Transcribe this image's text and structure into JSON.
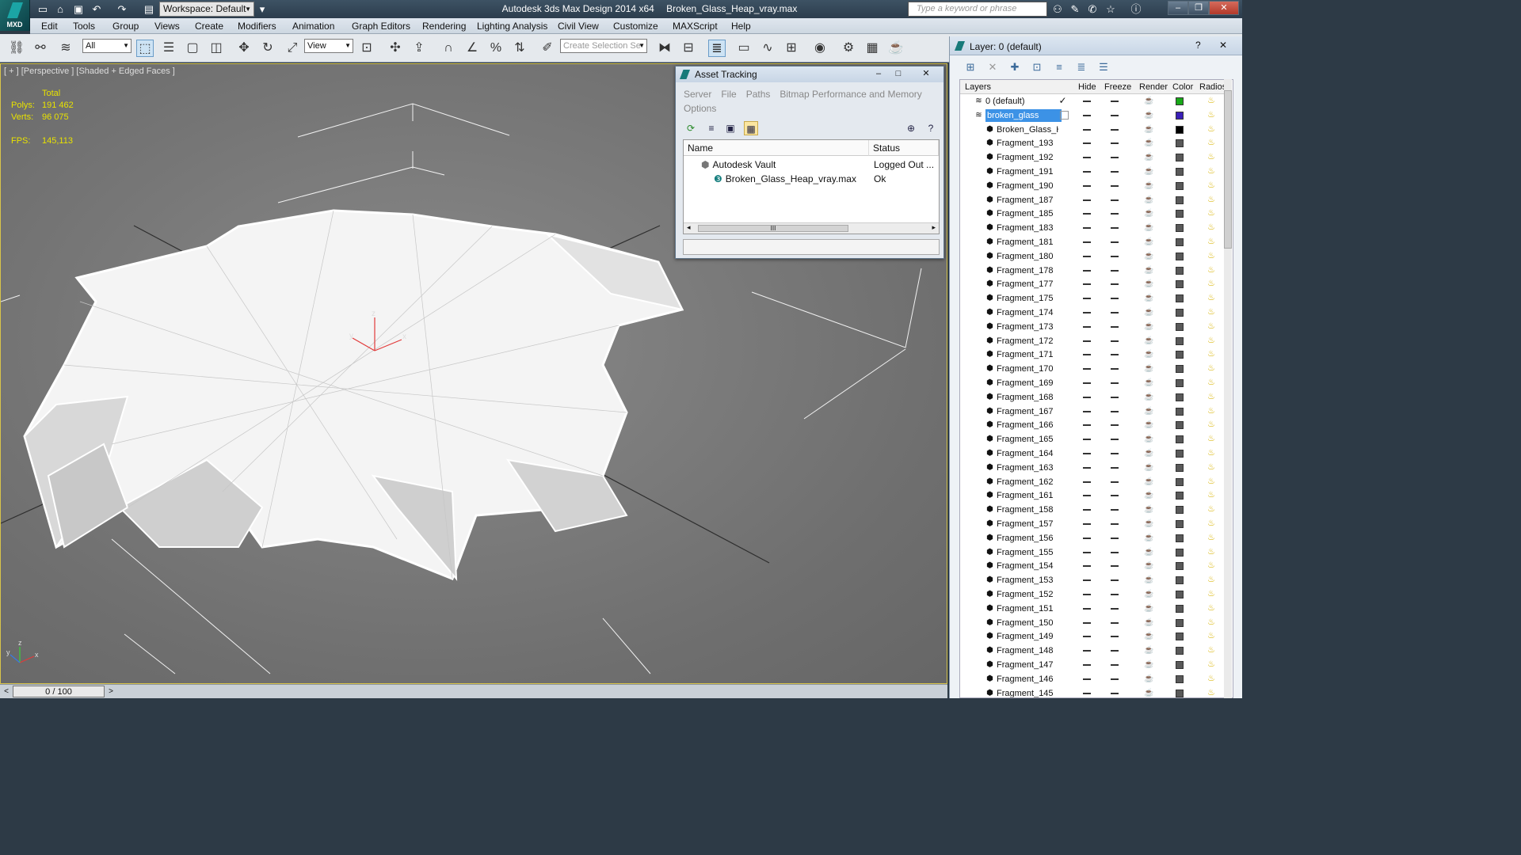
{
  "app": {
    "logo_text": "MXD",
    "title": "Autodesk 3ds Max Design 2014 x64",
    "file": "Broken_Glass_Heap_vray.max",
    "workspace": "Workspace: Default",
    "search_placeholder": "Type a keyword or phrase"
  },
  "menu": [
    "Edit",
    "Tools",
    "Group",
    "Views",
    "Create",
    "Modifiers",
    "Animation",
    "Graph Editors",
    "Rendering",
    "Lighting Analysis",
    "Civil View",
    "Customize",
    "MAXScript",
    "Help"
  ],
  "toolbar": {
    "filter_select": "All",
    "coord_select": "View",
    "selection_set_placeholder": "Create Selection Se"
  },
  "viewport": {
    "label": "[ + ] [Perspective ] [Shaded + Edged Faces ]",
    "stats_header": "Total",
    "polys_label": "Polys:",
    "polys_value": "191 462",
    "verts_label": "Verts:",
    "verts_value": "96 075",
    "fps_label": "FPS:",
    "fps_value": "145,113",
    "gizmo_x": "x",
    "gizmo_y": "y",
    "gizmo_z": "z"
  },
  "timeline": {
    "left": "<",
    "slider": "0 / 100",
    "right": ">"
  },
  "asset_tracking": {
    "title": "Asset Tracking",
    "menu": [
      "Server",
      "File",
      "Paths",
      "Bitmap Performance and Memory",
      "Options"
    ],
    "columns": [
      "Name",
      "Status"
    ],
    "rows": [
      {
        "name": "Autodesk Vault",
        "status": "Logged Out ..."
      },
      {
        "name": "Broken_Glass_Heap_vray.max",
        "status": "Ok"
      }
    ],
    "scroll_grip": "III"
  },
  "layer_panel": {
    "title": "Layer: 0 (default)",
    "help": "?",
    "close": "✕",
    "columns": [
      "Layers",
      "Hide",
      "Freeze",
      "Render",
      "Color",
      "Radios"
    ],
    "rows": [
      {
        "name": "0 (default)",
        "color": "#18a818",
        "kind": "layer",
        "check": true
      },
      {
        "name": "broken_glass",
        "color": "#3a1fb8",
        "kind": "layer",
        "selected": true
      },
      {
        "name": "Broken_Glass_He",
        "color": "#000000",
        "kind": "object"
      },
      {
        "name": "Fragment_193",
        "color": "#595959",
        "kind": "object"
      },
      {
        "name": "Fragment_192",
        "color": "#595959",
        "kind": "object"
      },
      {
        "name": "Fragment_191",
        "color": "#595959",
        "kind": "object"
      },
      {
        "name": "Fragment_190",
        "color": "#595959",
        "kind": "object"
      },
      {
        "name": "Fragment_187",
        "color": "#595959",
        "kind": "object"
      },
      {
        "name": "Fragment_185",
        "color": "#595959",
        "kind": "object"
      },
      {
        "name": "Fragment_183",
        "color": "#595959",
        "kind": "object"
      },
      {
        "name": "Fragment_181",
        "color": "#595959",
        "kind": "object"
      },
      {
        "name": "Fragment_180",
        "color": "#595959",
        "kind": "object"
      },
      {
        "name": "Fragment_178",
        "color": "#595959",
        "kind": "object"
      },
      {
        "name": "Fragment_177",
        "color": "#595959",
        "kind": "object"
      },
      {
        "name": "Fragment_175",
        "color": "#595959",
        "kind": "object"
      },
      {
        "name": "Fragment_174",
        "color": "#595959",
        "kind": "object"
      },
      {
        "name": "Fragment_173",
        "color": "#595959",
        "kind": "object"
      },
      {
        "name": "Fragment_172",
        "color": "#595959",
        "kind": "object"
      },
      {
        "name": "Fragment_171",
        "color": "#595959",
        "kind": "object"
      },
      {
        "name": "Fragment_170",
        "color": "#595959",
        "kind": "object"
      },
      {
        "name": "Fragment_169",
        "color": "#595959",
        "kind": "object"
      },
      {
        "name": "Fragment_168",
        "color": "#595959",
        "kind": "object"
      },
      {
        "name": "Fragment_167",
        "color": "#595959",
        "kind": "object"
      },
      {
        "name": "Fragment_166",
        "color": "#595959",
        "kind": "object"
      },
      {
        "name": "Fragment_165",
        "color": "#595959",
        "kind": "object"
      },
      {
        "name": "Fragment_164",
        "color": "#595959",
        "kind": "object"
      },
      {
        "name": "Fragment_163",
        "color": "#595959",
        "kind": "object"
      },
      {
        "name": "Fragment_162",
        "color": "#595959",
        "kind": "object"
      },
      {
        "name": "Fragment_161",
        "color": "#595959",
        "kind": "object"
      },
      {
        "name": "Fragment_158",
        "color": "#595959",
        "kind": "object"
      },
      {
        "name": "Fragment_157",
        "color": "#595959",
        "kind": "object"
      },
      {
        "name": "Fragment_156",
        "color": "#595959",
        "kind": "object"
      },
      {
        "name": "Fragment_155",
        "color": "#595959",
        "kind": "object"
      },
      {
        "name": "Fragment_154",
        "color": "#595959",
        "kind": "object"
      },
      {
        "name": "Fragment_153",
        "color": "#595959",
        "kind": "object"
      },
      {
        "name": "Fragment_152",
        "color": "#595959",
        "kind": "object"
      },
      {
        "name": "Fragment_151",
        "color": "#595959",
        "kind": "object"
      },
      {
        "name": "Fragment_150",
        "color": "#595959",
        "kind": "object"
      },
      {
        "name": "Fragment_149",
        "color": "#595959",
        "kind": "object"
      },
      {
        "name": "Fragment_148",
        "color": "#595959",
        "kind": "object"
      },
      {
        "name": "Fragment_147",
        "color": "#595959",
        "kind": "object"
      },
      {
        "name": "Fragment_146",
        "color": "#595959",
        "kind": "object"
      },
      {
        "name": "Fragment_145",
        "color": "#595959",
        "kind": "object"
      }
    ]
  }
}
